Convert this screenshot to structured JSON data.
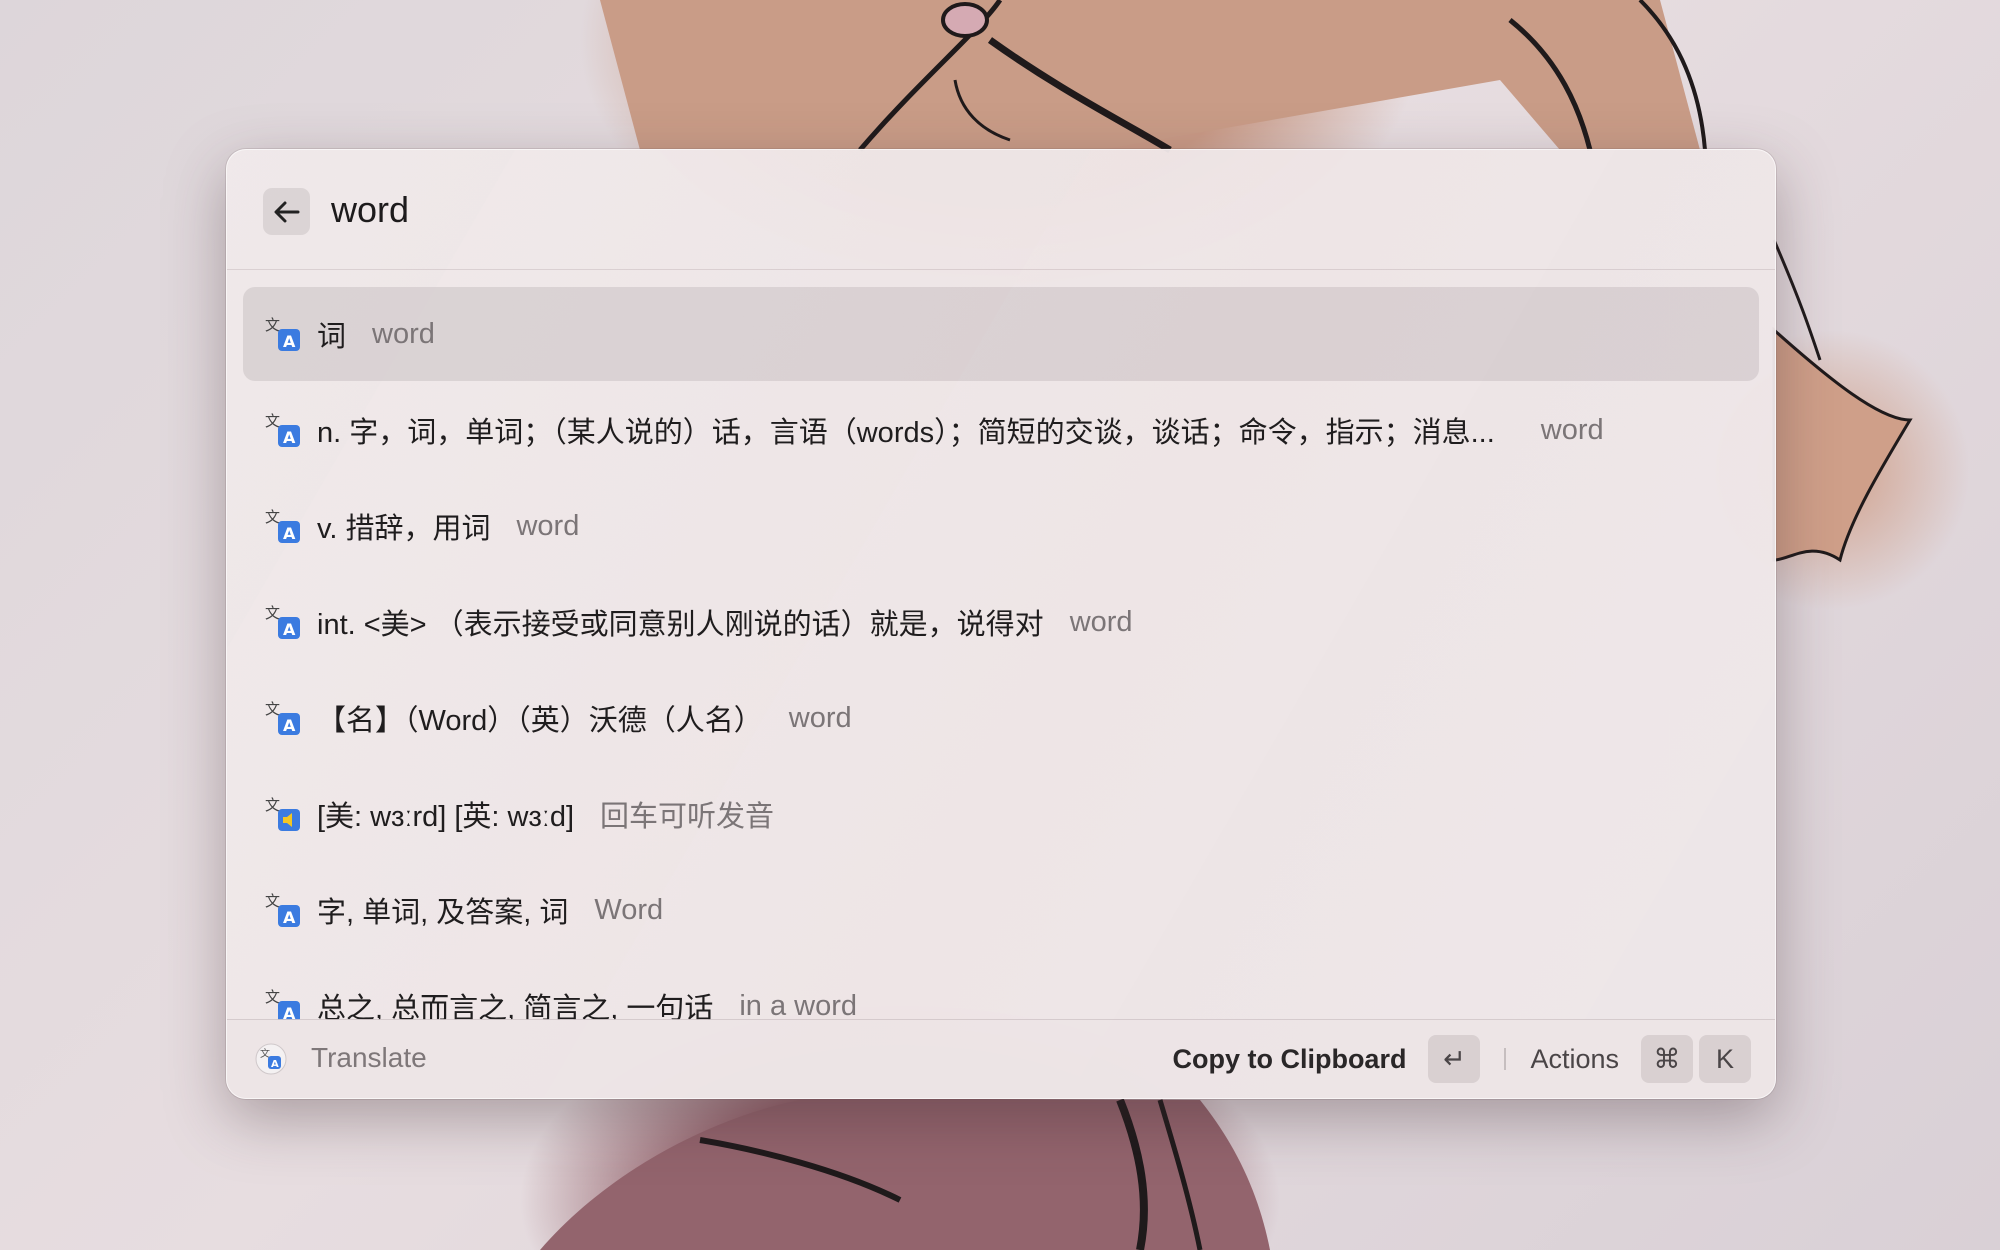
{
  "search": {
    "value": "word",
    "back_icon": "arrow-left-icon"
  },
  "results": [
    {
      "title": "词",
      "subtitle": "word",
      "icon": "translate-icon",
      "selected": true
    },
    {
      "title": "n. 字，词，单词；（某人说的）话，言语（words）；简短的交谈，谈话；命令，指示；消息...",
      "subtitle": "word",
      "icon": "translate-icon"
    },
    {
      "title": "v. 措辞，用词",
      "subtitle": "word",
      "icon": "translate-icon"
    },
    {
      "title": "int. <美> （表示接受或同意别人刚说的话）就是，说得对",
      "subtitle": "word",
      "icon": "translate-icon"
    },
    {
      "title": "【名】（Word）（英）沃德（人名）",
      "subtitle": "word",
      "icon": "translate-icon"
    },
    {
      "title": "[美: wɜːrd] [英: wɜːd]",
      "subtitle": "回车可听发音",
      "icon": "pronunciation-icon"
    },
    {
      "title": "字, 单词, 及答案, 词",
      "subtitle": "Word",
      "icon": "translate-icon"
    },
    {
      "title": "总之, 总而言之, 简言之, 一句话",
      "subtitle": "in a word",
      "icon": "translate-icon"
    }
  ],
  "footer": {
    "app_name": "Translate",
    "primary_action": "Copy to Clipboard",
    "primary_key": "↵",
    "actions_label": "Actions",
    "actions_keys": [
      "⌘",
      "K"
    ]
  },
  "colors": {
    "icon_blue": "#3b7be0",
    "selected_row": "#d8d0d1"
  }
}
